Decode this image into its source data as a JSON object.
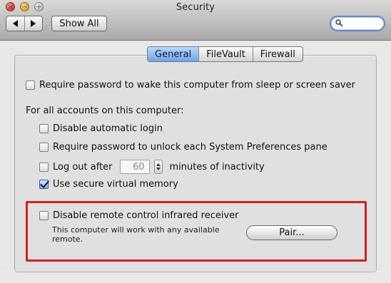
{
  "window": {
    "title": "Security",
    "controls": {
      "close_glyph": "×",
      "minimize_glyph": "−",
      "zoom_glyph": "+"
    }
  },
  "toolbar": {
    "back_icon": "back-arrow-icon",
    "forward_icon": "forward-arrow-icon",
    "show_all_label": "Show All",
    "search_icon": "search-icon",
    "search_value": "",
    "search_placeholder": ""
  },
  "tabs": [
    {
      "label": "General",
      "active": true
    },
    {
      "label": "FileVault",
      "active": false
    },
    {
      "label": "Firewall",
      "active": false
    }
  ],
  "general": {
    "require_password_wake_label": "Require password to wake this computer from sleep or screen saver",
    "require_password_wake_checked": false,
    "all_accounts_heading": "For all accounts on this computer:",
    "disable_auto_login_label": "Disable automatic login",
    "disable_auto_login_checked": false,
    "require_password_unlock_label": "Require password to unlock each System Preferences pane",
    "require_password_unlock_checked": false,
    "logout_label_before": "Log out after",
    "logout_minutes_value": "60",
    "logout_label_after": "minutes of inactivity",
    "logout_checked": false,
    "secure_vm_label": "Use secure virtual memory",
    "secure_vm_checked": true,
    "disable_ir_label": "Disable remote control infrared receiver",
    "disable_ir_checked": false,
    "ir_note": "This computer will work with any available remote.",
    "pair_button_label": "Pair..."
  },
  "colors": {
    "accent_blue": "#6fa3e8",
    "highlight_red": "#d1201d"
  }
}
